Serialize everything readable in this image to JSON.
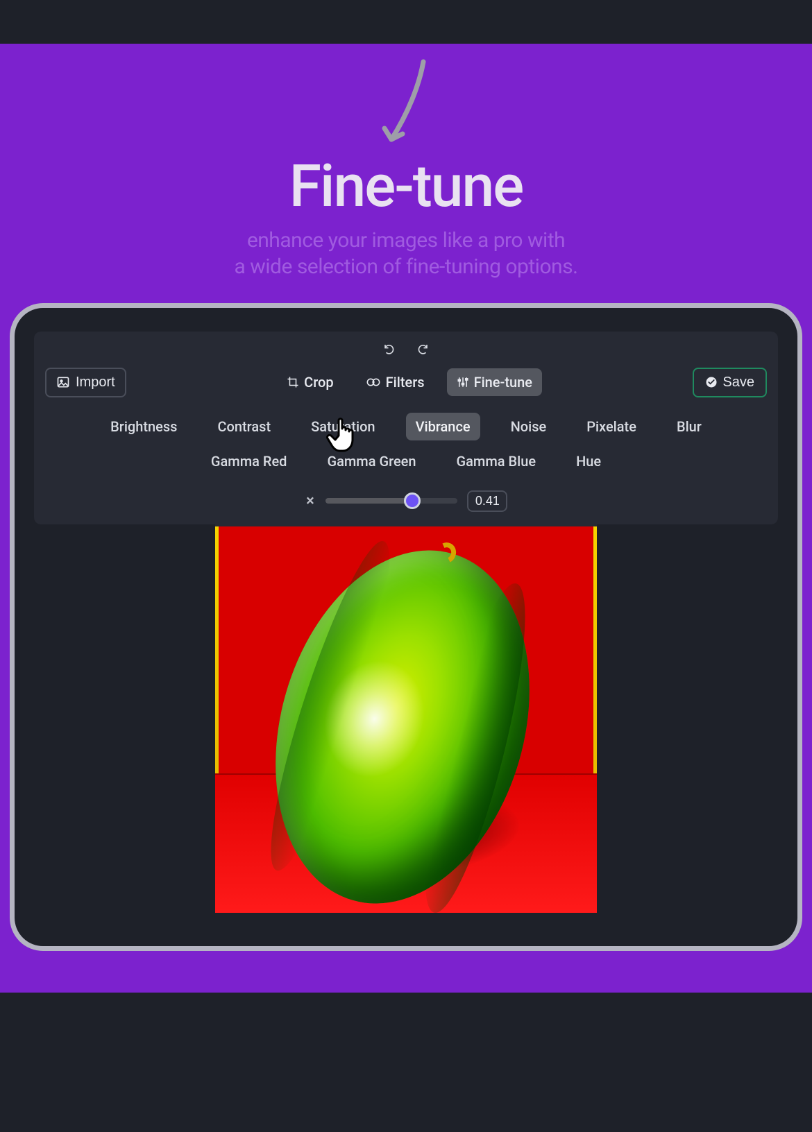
{
  "hero": {
    "title": "Fine-tune",
    "subtitle_line1": "enhance your images like a pro with",
    "subtitle_line2": "a wide selection of fine-tuning options."
  },
  "toolbar": {
    "import_label": "Import",
    "save_label": "Save",
    "tabs": {
      "crop": "Crop",
      "filters": "Filters",
      "finetune": "Fine-tune"
    }
  },
  "adjustments": [
    "Brightness",
    "Contrast",
    "Saturation",
    "Vibrance",
    "Noise",
    "Pixelate",
    "Blur",
    "Gamma Red",
    "Gamma Green",
    "Gamma Blue",
    "Hue"
  ],
  "active_adjustment": "Vibrance",
  "slider": {
    "value_display": "0.41",
    "value_numeric": 0.41,
    "fill_percent": 66
  },
  "icons": {
    "undo": "undo-icon",
    "redo": "redo-icon",
    "image": "image-icon",
    "crop": "crop-icon",
    "filters": "filters-icon",
    "sliders": "sliders-icon",
    "check": "check-circle-icon",
    "reset": "close-icon",
    "cursor": "pointer-hand-icon"
  },
  "colors": {
    "purple_bg": "#7c22ce",
    "dark": "#1e2129",
    "panel": "#272a34",
    "accent_green": "#1f8a5f",
    "slider_thumb": "#6d52f4"
  }
}
